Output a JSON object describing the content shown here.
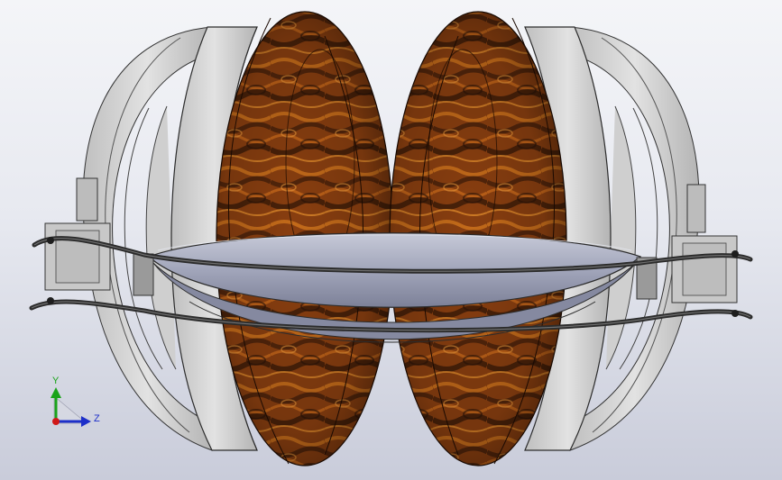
{
  "viewport": {
    "background_top": "#f4f5f8",
    "background_bottom": "#c9ccda"
  },
  "model": {
    "subject": "headphones-3d-model",
    "band_color": "#d6d6d6",
    "ear_cup_material": "wood-burl",
    "wood_base": "#8a3f10",
    "wood_highlight": "#d2761d",
    "wood_dark": "#3a1a08",
    "headband_cushion_color": "#9fa3b8",
    "wire_color": "#2b2b2b"
  },
  "triad": {
    "y_label": "Y",
    "z_label": "Z",
    "y_color": "#1aa31a",
    "z_color": "#1d2fc9",
    "x_color": "#d01818"
  }
}
